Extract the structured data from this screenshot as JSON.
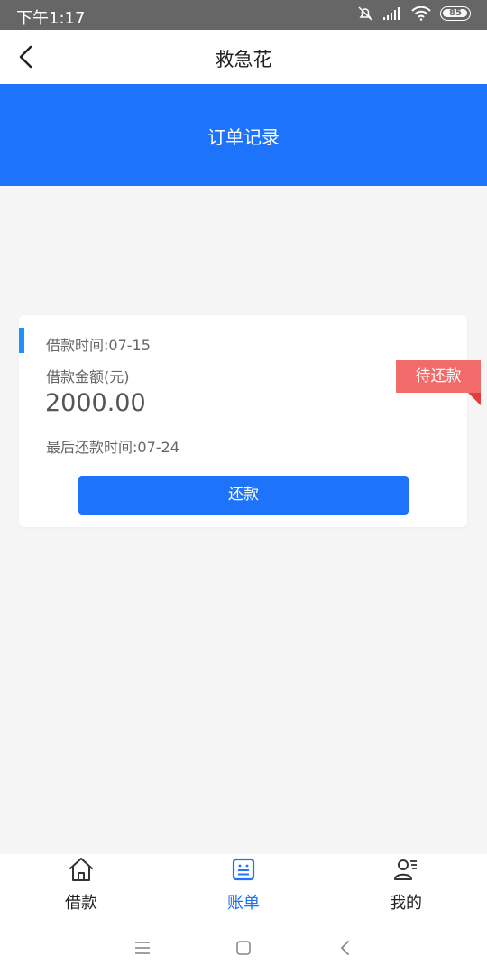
{
  "status_bar": {
    "time": "下午1:17",
    "battery": "85"
  },
  "nav": {
    "title": "救急花",
    "back_icon": "chevron-left-icon"
  },
  "hero": {
    "title": "订单记录"
  },
  "order": {
    "loan_time": "借款时间:07-15",
    "amount_label": "借款金额(元)",
    "amount": "2000.00",
    "last_repay_time": "最后还款时间:07-24",
    "status": "待还款",
    "repay_button": "还款"
  },
  "tabs": [
    {
      "label": "借款",
      "icon": "home-icon",
      "active": false
    },
    {
      "label": "账单",
      "icon": "bill-icon",
      "active": true
    },
    {
      "label": "我的",
      "icon": "profile-icon",
      "active": false
    }
  ],
  "colors": {
    "primary": "#1e73fb",
    "tag": "#f26b6b",
    "tag_fold": "#e33d3d",
    "accent": "#1e90ff"
  }
}
